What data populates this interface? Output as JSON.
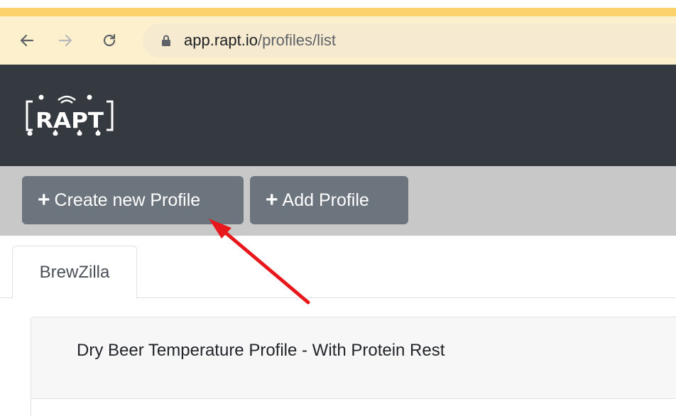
{
  "browser": {
    "url_host": "app.rapt.io",
    "url_path": "/profiles/list"
  },
  "header": {
    "logo_text": "RAPT"
  },
  "toolbar": {
    "create_label": "Create new Profile",
    "add_label": "Add Profile"
  },
  "tabs": [
    {
      "label": "BrewZilla"
    }
  ],
  "profiles": [
    {
      "name": "Dry Beer Temperature Profile - With Protein Rest"
    }
  ],
  "colors": {
    "header_bg": "#343a40",
    "button_bg": "#6c757d",
    "toolbar_bg": "#c8c8c8",
    "annotation_arrow": "#e8171b"
  }
}
